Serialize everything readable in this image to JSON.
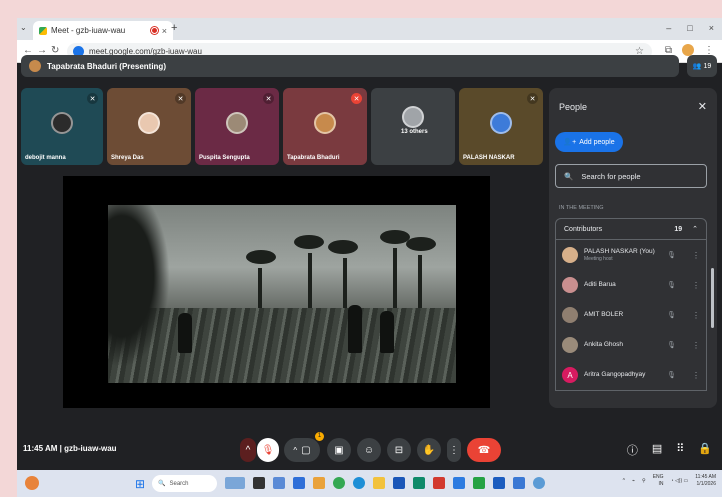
{
  "browser": {
    "tab_title": "Meet - gzb-iuaw-wau",
    "tab_close": "×",
    "new_tab": "+",
    "url": "meet.google.com/gzb-iuaw-wau",
    "minimize": "–",
    "maximize": "□",
    "close": "×",
    "tab_dropdown": "⌄"
  },
  "presenting_banner": {
    "label": "Tapabrata Bhaduri (Presenting)",
    "participant_count": "19"
  },
  "tiles": [
    {
      "name": "debojit manna",
      "color": "#1f4a55"
    },
    {
      "name": "Shreya Das",
      "color": "#6d4c35"
    },
    {
      "name": "Puspita Sengupta",
      "color": "#6b2a45"
    },
    {
      "name": "Tapabrata Bhaduri",
      "color": "#7a3a3f"
    },
    {
      "name": "13 others",
      "color": "#3c4043"
    },
    {
      "name": "PALASH NASKAR",
      "color": "#5a4a2a"
    }
  ],
  "meeting": {
    "time": "11:45 AM",
    "separator": "|",
    "code": "gzb-iuaw-wau"
  },
  "people_panel": {
    "title": "People",
    "add_people": "Add people",
    "search_placeholder": "Search for people",
    "section_label": "IN THE MEETING",
    "group_label": "Contributors",
    "group_count": "19",
    "participants": [
      {
        "name": "PALASH NASKAR (You)",
        "subtitle": "Meeting host",
        "avatar_color": "#d7b08a",
        "initial": ""
      },
      {
        "name": "Aditi Barua",
        "subtitle": "",
        "avatar_color": "#c98f8f",
        "initial": ""
      },
      {
        "name": "AMIT BOLER",
        "subtitle": "",
        "avatar_color": "#8f7f70",
        "initial": ""
      },
      {
        "name": "Ankita Ghosh",
        "subtitle": "",
        "avatar_color": "#9a8b7a",
        "initial": ""
      },
      {
        "name": "Aritra Gangopadhyay",
        "subtitle": "",
        "avatar_color": "#d81b60",
        "initial": "A"
      }
    ]
  },
  "taskbar": {
    "search_label": "Search",
    "lang_top": "ENG",
    "lang_bottom": "IN",
    "clock_time": "11:45 AM",
    "clock_date": "1/1/2026"
  },
  "controls_badge": "1"
}
